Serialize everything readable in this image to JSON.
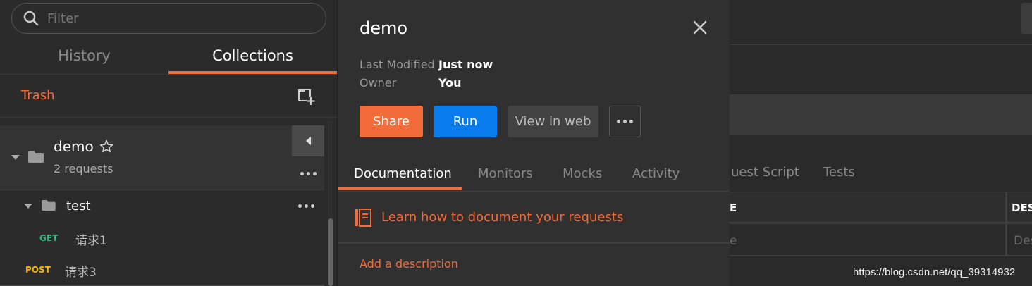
{
  "sidebar": {
    "filter_placeholder": "Filter",
    "tabs": [
      {
        "label": "History",
        "active": false
      },
      {
        "label": "Collections",
        "active": true
      }
    ],
    "trash_label": "Trash",
    "collection": {
      "name": "demo",
      "count": "2 requests",
      "folder": {
        "name": "test",
        "requests": [
          {
            "method": "GET",
            "name": "请求1",
            "color": "#2fb67c"
          },
          {
            "method": "POST",
            "name": "请求3",
            "color": "#f5b400"
          }
        ]
      }
    }
  },
  "panel": {
    "title": "demo",
    "last_modified_label": "Last Modified",
    "last_modified_value": "Just now",
    "owner_label": "Owner",
    "owner_value": "You",
    "buttons": {
      "share": "Share",
      "run": "Run",
      "view_web": "View in web"
    },
    "tabs": [
      "Documentation",
      "Monitors",
      "Mocks",
      "Activity"
    ],
    "learn_text": "Learn how to document your requests",
    "add_description": "Add a description"
  },
  "background": {
    "tab_pre_request": "uest Script",
    "tab_tests": "Tests",
    "column_key_fragment": "E",
    "column_desc_fragment": "DES",
    "cell_value_fragment": "e",
    "cell_desc_fragment": "Des"
  },
  "watermark": "https://blog.csdn.net/qq_39314932",
  "colors": {
    "accent": "#f26b3a",
    "run": "#097bed"
  }
}
